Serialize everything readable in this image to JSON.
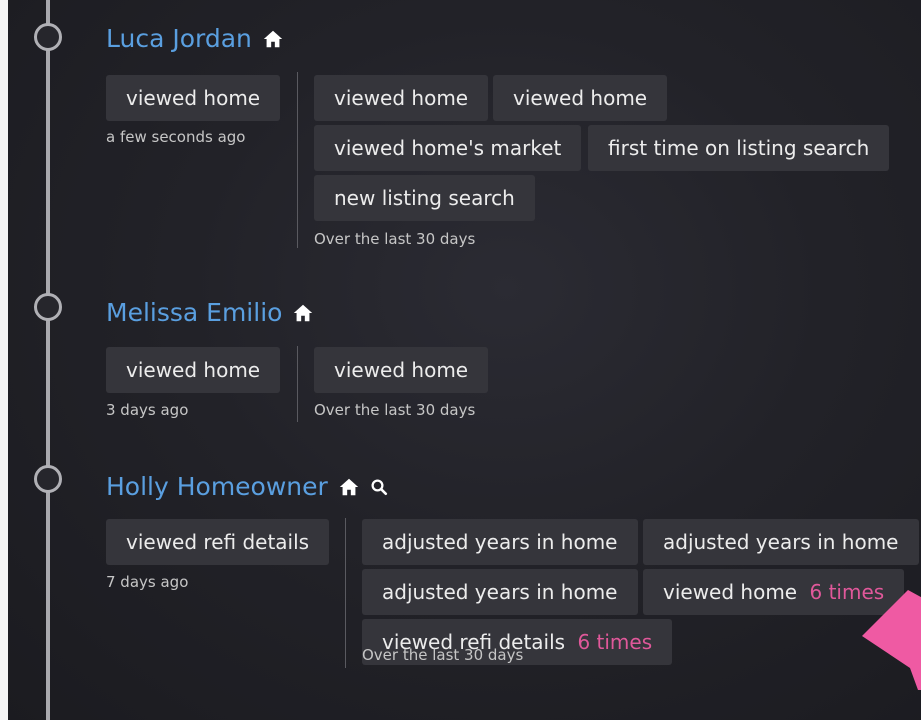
{
  "entries": [
    {
      "name": "Luca Jordan",
      "icons": [
        "home-icon"
      ],
      "latest": {
        "label": "viewed home",
        "time": "a few seconds ago"
      },
      "history": {
        "chips": [
          {
            "label": "viewed home"
          },
          {
            "label": "viewed home"
          },
          {
            "label": "viewed home's market"
          },
          {
            "label": "first time on listing search"
          },
          {
            "label": "new listing search"
          }
        ],
        "footer": "Over the last 30 days"
      }
    },
    {
      "name": "Melissa Emilio",
      "icons": [
        "home-icon"
      ],
      "latest": {
        "label": "viewed home",
        "time": "3 days ago"
      },
      "history": {
        "chips": [
          {
            "label": "viewed home"
          }
        ],
        "footer": "Over the last 30 days"
      }
    },
    {
      "name": "Holly Homeowner",
      "icons": [
        "home-icon",
        "search-icon"
      ],
      "latest": {
        "label": "viewed refi details",
        "time": "7 days ago"
      },
      "history": {
        "chips": [
          {
            "label": "adjusted years in home"
          },
          {
            "label": "adjusted years in home"
          },
          {
            "label": "adjusted years in home"
          },
          {
            "label": "viewed home",
            "count": "6 times"
          },
          {
            "label": "viewed refi details",
            "count": "6 times"
          }
        ],
        "footer": "Over the last 30 days"
      }
    }
  ],
  "colors": {
    "name_link": "#5a9fe0",
    "highlight": "#e0589a",
    "chip_bg": "#35353b",
    "background": "#222228",
    "arrow": "#ef5aa3"
  }
}
